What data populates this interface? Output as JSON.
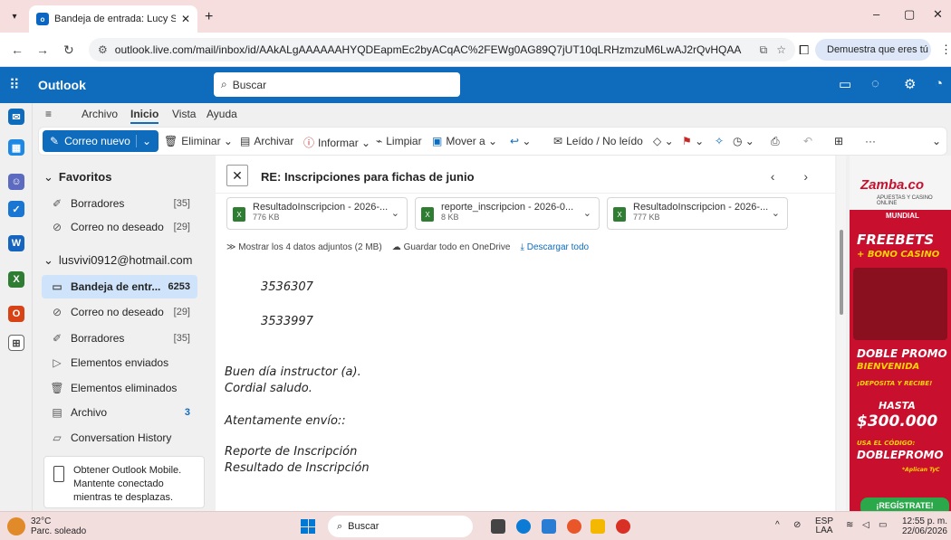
{
  "browser": {
    "tab_title": "Bandeja de entrada: Lucy Stella",
    "tab_close": "✕",
    "new_tab": "+",
    "url": "outlook.live.com/mail/inbox/id/AAkALgAAAAAAHYQDEapmEc2byACqAC%2FEWg0AG89Q7jUT10qLRHzmzuM6LwAJ2rQvHQAA",
    "profile_label": "Demuestra que eres tú",
    "win_min": "–",
    "win_restore": "▢",
    "win_close": "✕"
  },
  "header": {
    "brand": "Outlook",
    "search_placeholder": "Buscar"
  },
  "ribbon": {
    "tabs": [
      "Archivo",
      "Inicio",
      "Vista",
      "Ayuda"
    ],
    "new_mail": "Correo nuevo",
    "delete": "Eliminar",
    "archive": "Archivar",
    "report": "Informar",
    "sweep": "Limpiar",
    "move": "Mover a",
    "read_unread": "Leído / No leído",
    "more": "···"
  },
  "folders": {
    "favorites_title": "Favoritos",
    "favorites": [
      {
        "label": "Borradores",
        "count": "[35]"
      },
      {
        "label": "Correo no deseado",
        "count": "[29]"
      }
    ],
    "account_title": "lusvivi0912@hotmail.com",
    "account_items": [
      {
        "label": "Bandeja de entr...",
        "count": "6253"
      },
      {
        "label": "Correo no deseado",
        "count": "[29]"
      },
      {
        "label": "Borradores",
        "count": "[35]"
      },
      {
        "label": "Elementos enviados",
        "count": ""
      },
      {
        "label": "Elementos eliminados",
        "count": ""
      },
      {
        "label": "Archivo",
        "count": "3"
      },
      {
        "label": "Conversation History",
        "count": ""
      }
    ],
    "promo_text": "Obtener Outlook Mobile. Mantente conectado mientras te desplazas."
  },
  "message": {
    "subject": "RE: Inscripciones para fichas de junio",
    "attachments": [
      {
        "name": "ResultadoInscripcion - 2026-...",
        "size": "776 KB"
      },
      {
        "name": "reporte_inscripcion - 2026-0...",
        "size": "8 KB"
      },
      {
        "name": "ResultadoInscripcion - 2026-...",
        "size": "777 KB"
      }
    ],
    "show_attachments": "Mostrar los 4 datos adjuntos (2 MB)",
    "save_onedrive": "Guardar todo en OneDrive",
    "download_all": "Descargar todo",
    "body": {
      "num1": "3536307",
      "num2": "3533997",
      "greeting": "Buen día instructor (a).",
      "regards": "Cordial saludo.",
      "sending": "Atentamente envío::",
      "item1": "Reporte de Inscripción",
      "item2": "Resultado de Inscripción"
    }
  },
  "ad": {
    "brand": "Zamba.co",
    "tagline": "APUESTAS Y CASINO ONLINE",
    "badge": "MUNDIAL",
    "line1": "FREEBETS",
    "line2": "+ BONO CASINO",
    "line3": "DOBLE PROMO",
    "line4": "BIENVENIDA",
    "line5": "¡DEPOSITA Y RECIBE!",
    "line6": "HASTA",
    "amount": "$300.000",
    "code_label": "USA EL CÓDIGO:",
    "code": "DOBLEPROMO",
    "fine": "*Aplican TyC",
    "cta": "¡REGÍSTRATE!"
  },
  "taskbar": {
    "temp": "32°C",
    "weather": "Parc. soleado",
    "search": "Buscar",
    "lang1": "ESP",
    "lang2": "LAA",
    "time": "12:55 p. m.",
    "date": "22/06/2026"
  }
}
